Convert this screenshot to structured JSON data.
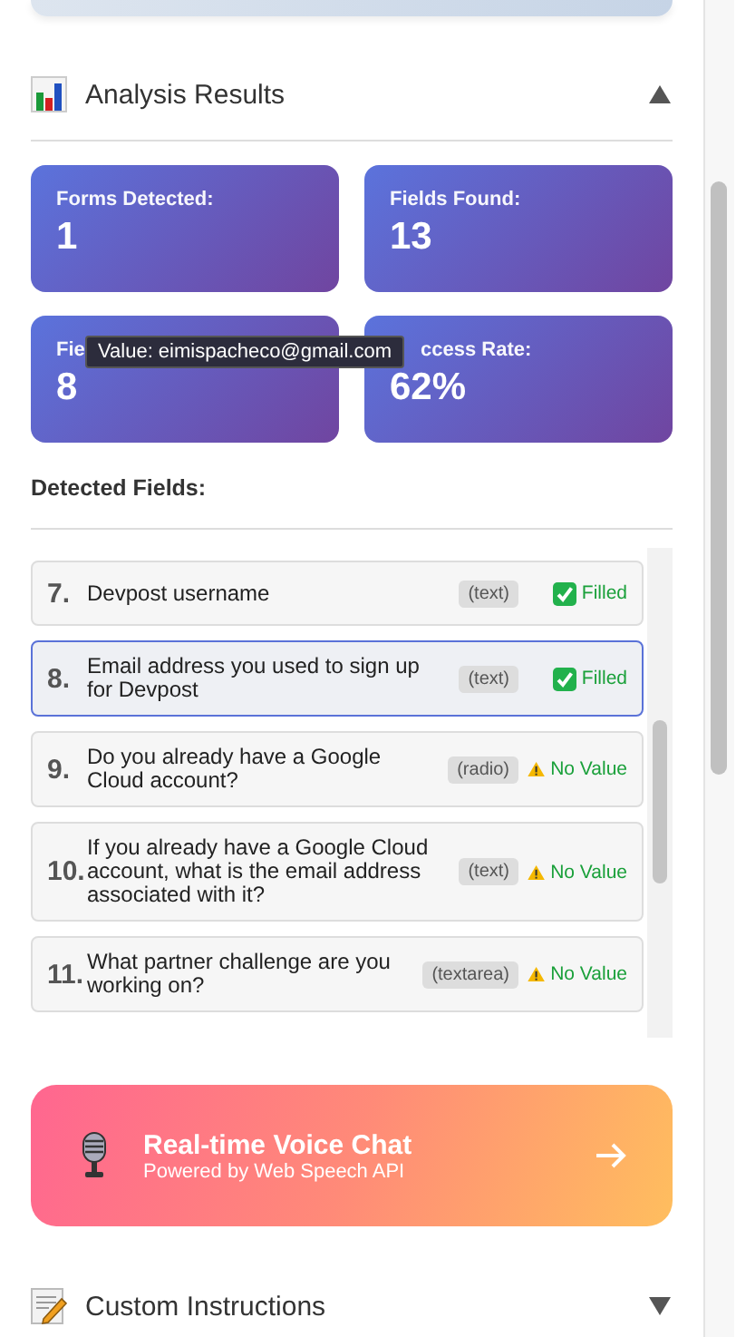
{
  "analysis_section": {
    "title": "Analysis Results",
    "expanded": true
  },
  "stats": [
    {
      "label": "Forms Detected:",
      "value": "1"
    },
    {
      "label": "Fields Found:",
      "value": "13"
    },
    {
      "label": "Fie",
      "value": "8"
    },
    {
      "label": "ccess Rate:",
      "value": "62%"
    }
  ],
  "tooltip": {
    "text": "Value: eimispacheco@gmail.com"
  },
  "detected_fields": {
    "title": "Detected Fields:",
    "items": [
      {
        "number": "7.",
        "label": "Devpost username",
        "type": "(text)",
        "kind": "filled",
        "status": "Filled",
        "selected": false
      },
      {
        "number": "8.",
        "label": "Email address you used to sign up for Devpost",
        "type": "(text)",
        "kind": "filled",
        "status": "Filled",
        "selected": true
      },
      {
        "number": "9.",
        "label": "Do you already have a Google Cloud account?",
        "type": "(radio)",
        "kind": "no_value",
        "status": "No Value",
        "selected": false
      },
      {
        "number": "10.",
        "label": "If you already have a Google Cloud account, what is the email address associated with it?",
        "type": "(text)",
        "kind": "no_value",
        "status": "No Value",
        "selected": false
      },
      {
        "number": "11.",
        "label": "What partner challenge are you working on?",
        "type": "(textarea)",
        "kind": "no_value",
        "status": "No Value",
        "selected": false
      }
    ]
  },
  "voice_chat": {
    "title": "Real-time Voice Chat",
    "subtitle": "Powered by Web Speech API"
  },
  "instructions_section": {
    "title": "Custom Instructions",
    "expanded": false
  }
}
